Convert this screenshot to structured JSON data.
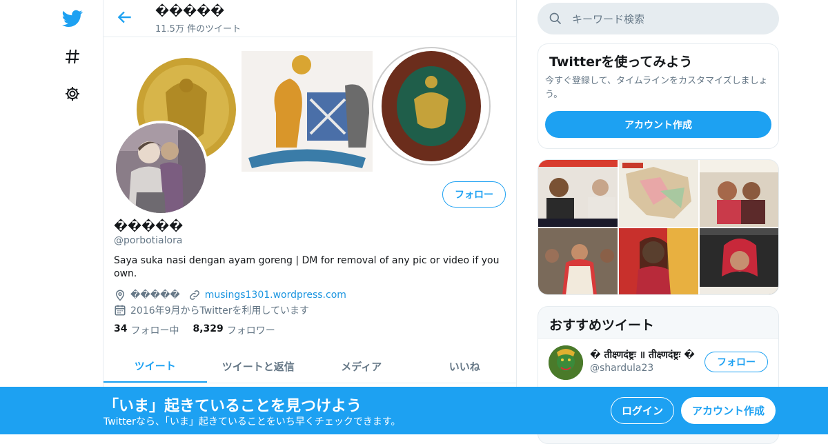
{
  "nav": {
    "icons": [
      "twitter-logo-icon",
      "hashtag-icon",
      "gear-icon"
    ]
  },
  "header": {
    "name": "�����",
    "tweet_count": "11.5万 件のツイート"
  },
  "profile": {
    "name": "�����",
    "handle": "@porbotialora",
    "bio": "Saya suka nasi dengan ayam goreng | DM for removal of any pic or video if you own.",
    "location": "�����",
    "website": "musings1301.wordpress.com",
    "joined": "2016年9月からTwitterを利用しています",
    "following_count": "34",
    "following_label": "フォロー中",
    "followers_count": "8,329",
    "followers_label": "フォロワー",
    "follow_label": "フォロー"
  },
  "tabs": [
    "ツイート",
    "ツイートと返信",
    "メディア",
    "いいね"
  ],
  "search": {
    "placeholder": "キーワード検索"
  },
  "signup_card": {
    "title": "Twitterを使ってみよう",
    "text": "今すぐ登録して、タイムラインをカスタマイズしましょう。",
    "button": "アカウント作成"
  },
  "recommended": {
    "title": "おすすめツイート",
    "name": "� तीक्ष्णदंष्ट्रः ॥ तीक्ष्णदंष्ट्रः �",
    "handle": "@shardula23",
    "follow_label": "フォロー"
  },
  "bottom_bar": {
    "title": "「いま」起きていることを見つけよう",
    "subtitle": "Twitterなら、「いま」起きていることをいち早くチェックできます。",
    "login": "ログイン",
    "signup": "アカウント作成"
  },
  "colors": {
    "accent": "#1da1f2",
    "text": "#14171a",
    "muted": "#657786",
    "border": "#e6ecf0"
  }
}
